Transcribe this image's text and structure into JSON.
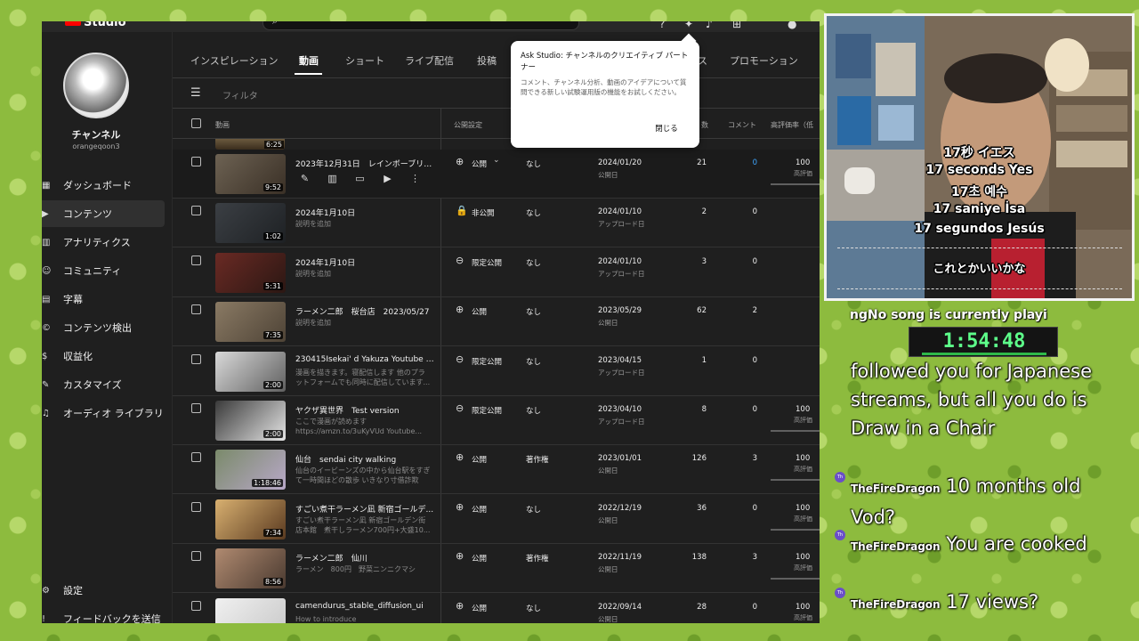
{
  "studio": {
    "logo": "Studio",
    "channel": {
      "name": "チャンネル",
      "handle": "orangeqoon3"
    },
    "nav": [
      {
        "label": "ダッシュボード",
        "icon": "dashboard-icon",
        "glyph": "▦"
      },
      {
        "label": "コンテンツ",
        "icon": "content-icon",
        "glyph": "▶"
      },
      {
        "label": "アナリティクス",
        "icon": "analytics-icon",
        "glyph": "▥"
      },
      {
        "label": "コミュニティ",
        "icon": "community-icon",
        "glyph": "☺"
      },
      {
        "label": "字幕",
        "icon": "subtitles-icon",
        "glyph": "▤"
      },
      {
        "label": "コンテンツ検出",
        "icon": "content-detection-icon",
        "glyph": "©"
      },
      {
        "label": "収益化",
        "icon": "monetization-icon",
        "glyph": "$"
      },
      {
        "label": "カスタマイズ",
        "icon": "customize-icon",
        "glyph": "✎"
      },
      {
        "label": "オーディオ ライブラリ",
        "icon": "audio-library-icon",
        "glyph": "♫"
      }
    ],
    "nav_bottom": [
      {
        "label": "設定",
        "icon": "settings-icon",
        "glyph": "⚙"
      },
      {
        "label": "フィードバックを送信",
        "icon": "feedback-icon",
        "glyph": "!"
      }
    ],
    "tabs": [
      "インスピレーション",
      "動画",
      "ショート",
      "ライブ配信",
      "投稿",
      "ス",
      "プロモーション"
    ],
    "filter_placeholder": "フィルタ",
    "columns": {
      "video": "動画",
      "visibility": "公開設定",
      "views": "数",
      "comments": "コメント",
      "likes": "高評価率（低"
    },
    "partial_duration": "6:25",
    "rows": [
      {
        "title": "2023年12月31日　レインボーブリッジ",
        "desc": "",
        "duration": "9:52",
        "vis_icon": "globe-icon",
        "vis_glyph": "⊕",
        "visibility": "公開",
        "restrictions": "なし",
        "date": "2024/01/20",
        "status": "公開日",
        "views": "21",
        "comments": "0",
        "likes": "100",
        "likes_label": "高評価"
      },
      {
        "title": "2024年1月10日",
        "desc": "説明を追加",
        "duration": "1:02",
        "vis_icon": "lock-icon",
        "vis_glyph": "🔒",
        "visibility": "非公開",
        "restrictions": "なし",
        "date": "2024/01/10",
        "status": "アップロード日",
        "views": "2",
        "comments": "0",
        "likes": "",
        "likes_label": ""
      },
      {
        "title": "2024年1月10日",
        "desc": "説明を追加",
        "duration": "5:31",
        "vis_icon": "link-icon",
        "vis_glyph": "⊖",
        "visibility": "限定公開",
        "restrictions": "なし",
        "date": "2024/01/10",
        "status": "アップロード日",
        "views": "3",
        "comments": "0",
        "likes": "",
        "likes_label": ""
      },
      {
        "title": "ラーメン二郎　桜台店　2023/05/27",
        "desc": "説明を追加",
        "duration": "7:35",
        "vis_icon": "globe-icon",
        "vis_glyph": "⊕",
        "visibility": "公開",
        "restrictions": "なし",
        "date": "2023/05/29",
        "status": "公開日",
        "views": "62",
        "comments": "2",
        "likes": "",
        "likes_label": ""
      },
      {
        "title": "230415Isekai' d  Yakuza Youtube Res...",
        "desc": "漫画を描きます。寝配信します 他のプラットフォームでも同時に配信しています...",
        "duration": "2:00",
        "vis_icon": "link-icon",
        "vis_glyph": "⊖",
        "visibility": "限定公開",
        "restrictions": "なし",
        "date": "2023/04/15",
        "status": "アップロード日",
        "views": "1",
        "comments": "0",
        "likes": "",
        "likes_label": ""
      },
      {
        "title": "ヤクザ異世界　Test version",
        "desc": "ここで漫画が読めます https://amzn.to/3uKyVUd Youtube...",
        "duration": "2:00",
        "vis_icon": "link-icon",
        "vis_glyph": "⊖",
        "visibility": "限定公開",
        "restrictions": "なし",
        "date": "2023/04/10",
        "status": "アップロード日",
        "views": "8",
        "comments": "0",
        "likes": "100",
        "likes_label": "高評価"
      },
      {
        "title": "仙台　sendai city walking",
        "desc": "仙台のイービーンズの中から仙台駅をすぎて一時間ほどの散歩 いきなり寸借詐欺に...",
        "duration": "1:18:46",
        "vis_icon": "globe-icon",
        "vis_glyph": "⊕",
        "visibility": "公開",
        "restrictions": "著作権",
        "date": "2023/01/01",
        "status": "公開日",
        "views": "126",
        "comments": "3",
        "likes": "100",
        "likes_label": "高評価"
      },
      {
        "title": "すごい煮干ラーメン凪 新宿ゴールデ...",
        "desc": "すごい煮干ラーメン凪 新宿ゴールデン街店本館　煮干しラーメン700円+大盛10...",
        "duration": "7:34",
        "vis_icon": "globe-icon",
        "vis_glyph": "⊕",
        "visibility": "公開",
        "restrictions": "なし",
        "date": "2022/12/19",
        "status": "公開日",
        "views": "36",
        "comments": "0",
        "likes": "100",
        "likes_label": "高評価"
      },
      {
        "title": "ラーメン二郎　仙川",
        "desc": "ラーメン　800円　野菜ニンニクマシ",
        "duration": "8:56",
        "vis_icon": "globe-icon",
        "vis_glyph": "⊕",
        "visibility": "公開",
        "restrictions": "著作権",
        "date": "2022/11/19",
        "status": "公開日",
        "views": "138",
        "comments": "3",
        "likes": "100",
        "likes_label": "高評価"
      },
      {
        "title": "camendurus_stable_diffusion_ui",
        "desc": "How to introduce",
        "duration": "",
        "vis_icon": "globe-icon",
        "vis_glyph": "⊕",
        "visibility": "公開",
        "restrictions": "なし",
        "date": "2022/09/14",
        "status": "公開日",
        "views": "28",
        "comments": "0",
        "likes": "100",
        "likes_label": "高評価"
      }
    ],
    "popup": {
      "title": "Ask Studio: チャンネルのクリエイティブ パートナー",
      "body": "コメント、チャンネル分析、動画のアイデアについて質問できる新しい試験運用版の機能をお試しください。",
      "close": "閉じる"
    }
  },
  "webcam": {
    "subtitles": [
      "17秒 イエス",
      "17 seconds Yes",
      "17초 예수",
      "17 saniye İsa",
      "17 segundos Jesús"
    ],
    "caption": "これとかいいかな"
  },
  "overlay": {
    "now_playing": "ngNo song is currently playi",
    "timer": "1:54:48"
  },
  "chat": [
    {
      "user": "",
      "text": "followed you for Japanese streams, but all you do is Draw in a Chair"
    },
    {
      "user": "TheFireDragon",
      "text": "10 months old Vod?"
    },
    {
      "user": "TheFireDragon",
      "text": "You are cooked"
    },
    {
      "user": "TheFireDragon",
      "text": "17 views?"
    }
  ],
  "colors": {
    "background": "#8dbb3e",
    "studio_bg": "#1f1f1f",
    "link": "#3ea6ff",
    "timer": "#5dff8a"
  }
}
